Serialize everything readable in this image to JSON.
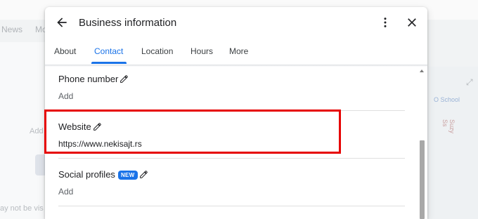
{
  "background": {
    "tabs": [
      "News",
      "Mo"
    ],
    "address_fragment": "Add",
    "note_fragment": "ay not be vis",
    "map_label": "O School",
    "road_label": "Suzy Ss"
  },
  "dialog": {
    "title": "Business information",
    "icons": {
      "back": "arrow-back-icon",
      "more": "more-vert-icon",
      "close": "close-icon",
      "edit": "pencil-icon"
    },
    "tabs": [
      {
        "label": "About",
        "active": false
      },
      {
        "label": "Contact",
        "active": true
      },
      {
        "label": "Location",
        "active": false
      },
      {
        "label": "Hours",
        "active": false
      },
      {
        "label": "More",
        "active": false
      }
    ],
    "fields": {
      "phone": {
        "label": "Phone number",
        "action": "Add"
      },
      "website": {
        "label": "Website",
        "value": "https://www.nekisajt.rs"
      },
      "social": {
        "label": "Social profiles",
        "badge": "NEW",
        "action": "Add"
      }
    }
  },
  "colors": {
    "accent": "#1a73e8",
    "highlight": "#e60000"
  }
}
